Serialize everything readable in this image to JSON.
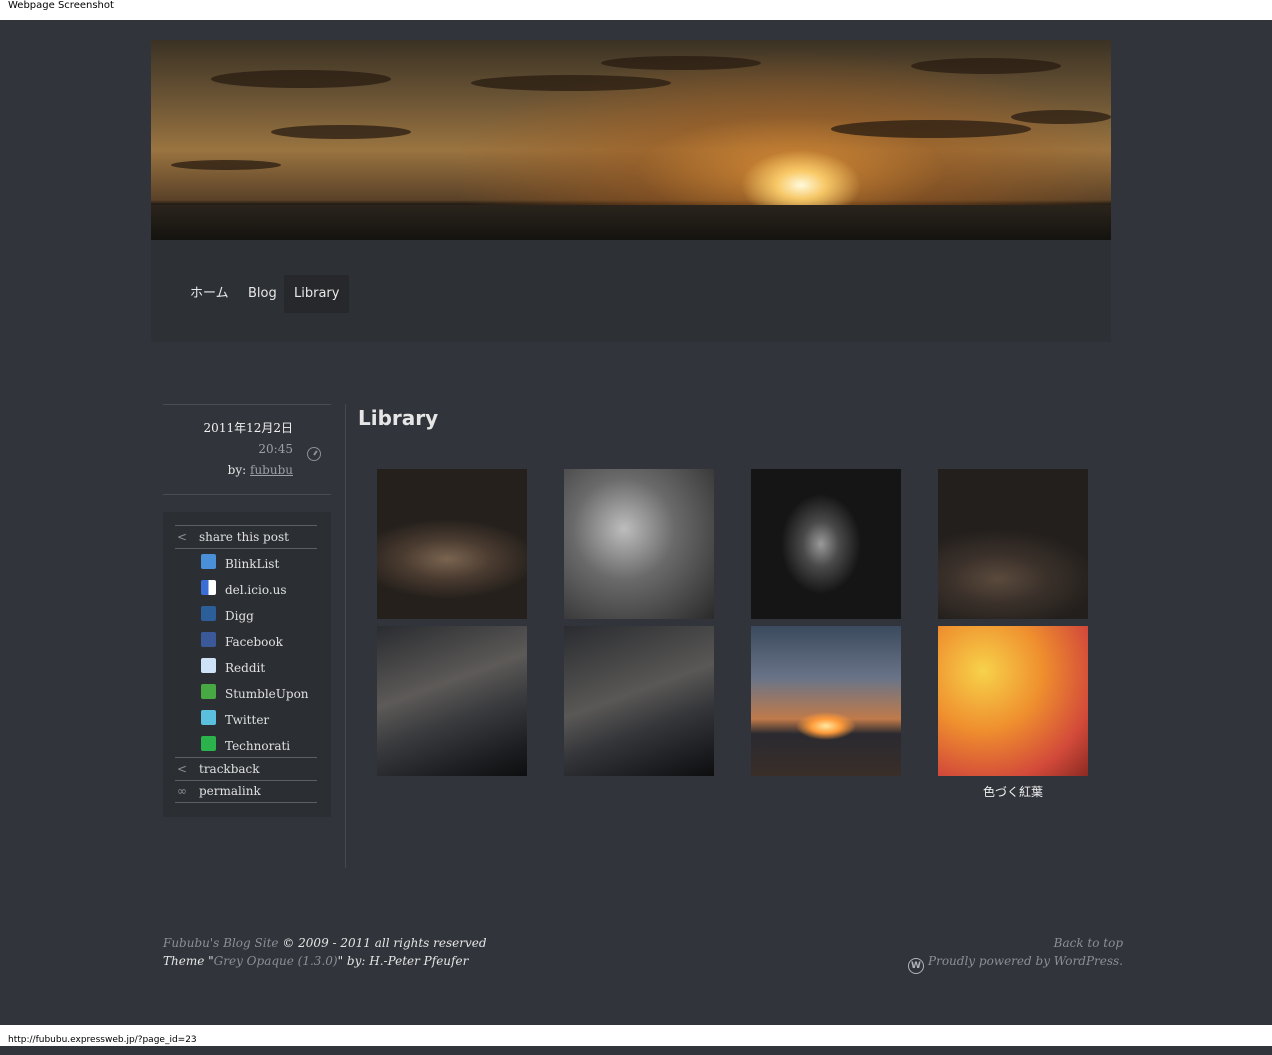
{
  "window": {
    "title": "Webpage Screenshot",
    "status_url": "http://fububu.expressweb.jp/?page_id=23"
  },
  "nav": {
    "items": [
      {
        "label": "ホーム"
      },
      {
        "label": "Blog"
      },
      {
        "label": "Library"
      }
    ],
    "active": "Library"
  },
  "post_meta": {
    "date": "2011年12月2日",
    "time": "20:45",
    "by_label": "by:",
    "author": "fububu"
  },
  "share": {
    "heading": "share this post",
    "services": [
      {
        "label": "BlinkList",
        "icon": "blinklist-icon",
        "color": "#4a90d9"
      },
      {
        "label": "del.icio.us",
        "icon": "delicious-icon",
        "color": "#3a6ed6"
      },
      {
        "label": "Digg",
        "icon": "digg-icon",
        "color": "#2c5f99"
      },
      {
        "label": "Facebook",
        "icon": "facebook-icon",
        "color": "#3b5998"
      },
      {
        "label": "Reddit",
        "icon": "reddit-icon",
        "color": "#cee3f8"
      },
      {
        "label": "StumbleUpon",
        "icon": "stumbleupon-icon",
        "color": "#48a843"
      },
      {
        "label": "Twitter",
        "icon": "twitter-icon",
        "color": "#5bc0de"
      },
      {
        "label": "Technorati",
        "icon": "technorati-icon",
        "color": "#2bb24c"
      }
    ],
    "trackback": "trackback",
    "permalink": "permalink"
  },
  "page": {
    "title": "Library",
    "gallery": [
      {
        "caption": "",
        "icon": "milky-way-thumbnail"
      },
      {
        "caption": "",
        "icon": "nebula-thumbnail"
      },
      {
        "caption": "",
        "icon": "heart-nebula-thumbnail"
      },
      {
        "caption": "",
        "icon": "star-field-thumbnail"
      },
      {
        "caption": "",
        "icon": "milky-way-horizon-thumbnail"
      },
      {
        "caption": "",
        "icon": "milky-way-horizon-2-thumbnail"
      },
      {
        "caption": "",
        "icon": "sunset-sea-thumbnail"
      },
      {
        "caption": "色づく紅葉",
        "icon": "autumn-leaves-thumbnail"
      }
    ]
  },
  "footer": {
    "site_name": "Fububu's Blog Site",
    "copyright": "© 2009 - 2011 all rights reserved",
    "theme_prefix": "Theme \"",
    "theme_name": "Grey Opaque (1.3.0)",
    "theme_suffix": "\" by: H.-Peter Pfeufer",
    "back_to_top": "Back to top",
    "powered_by": "Proudly powered by WordPress."
  }
}
